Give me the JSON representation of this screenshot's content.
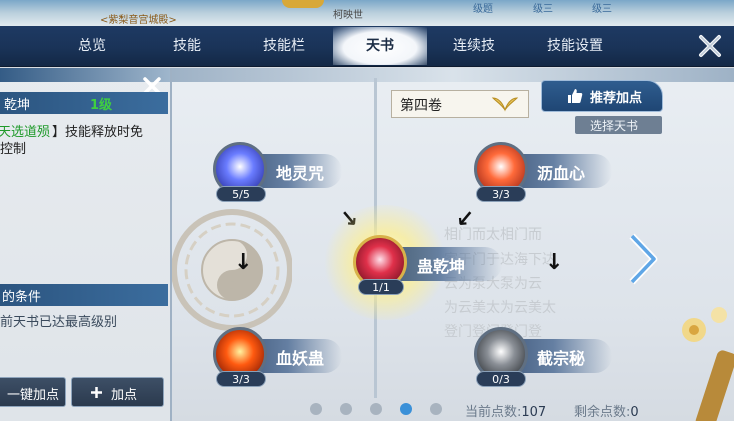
{
  "top_strip": {
    "title": "<紫梨音宫城殿>",
    "player_name": "柯映世",
    "label_a": "级题",
    "label_b": "级三",
    "label_c": "级三"
  },
  "tabs": [
    {
      "label": "总览"
    },
    {
      "label": "技能"
    },
    {
      "label": "技能栏"
    },
    {
      "label": "天书"
    },
    {
      "label": "连续技"
    },
    {
      "label": "技能设置"
    }
  ],
  "left_panel": {
    "skill_name": "乾坤",
    "skill_level": "1级",
    "desc_part1": "天选道殒",
    "desc_part2": "】技能释放时免",
    "desc_line2": "控制",
    "cond_header": "的条件",
    "cond_text": "前天书已达最高级别",
    "btn_auto": "一键加点",
    "btn_add": "加点"
  },
  "volume": {
    "label": "第四卷"
  },
  "recommend": {
    "label": "推荐加点",
    "select_label": "选择天书"
  },
  "nodes": [
    {
      "name": "地灵咒",
      "level": "5/5",
      "colors": [
        "#ffffff",
        "#6a7cff",
        "#1a1e8a"
      ]
    },
    {
      "name": "沥血心",
      "level": "3/3",
      "colors": [
        "#ffffff",
        "#ff6a3a",
        "#8a1a10"
      ]
    },
    {
      "name": "蛊乾坤",
      "level": "1/1",
      "colors": [
        "#ffe0ea",
        "#e0304a",
        "#5a0a18"
      ]
    },
    {
      "name": "血妖蛊",
      "level": "3/3",
      "colors": [
        "#fff3a0",
        "#ff5a10",
        "#6a0a00"
      ]
    },
    {
      "name": "截宗秘",
      "level": "0/3",
      "colors": [
        "#ffffff",
        "#8a8f96",
        "#1e2226"
      ]
    }
  ],
  "bg_text": [
    "相门而太相门而",
    "家于门于达海下达",
    "云为泵大泵为云",
    "为云美太为云美太",
    "登门登门登门登"
  ],
  "footer": {
    "current_label": "当前点数:",
    "current_value": "107",
    "remaining_label": "剩余点数:",
    "remaining_value": "0"
  },
  "page_dots": {
    "count": 5,
    "active": 4
  }
}
